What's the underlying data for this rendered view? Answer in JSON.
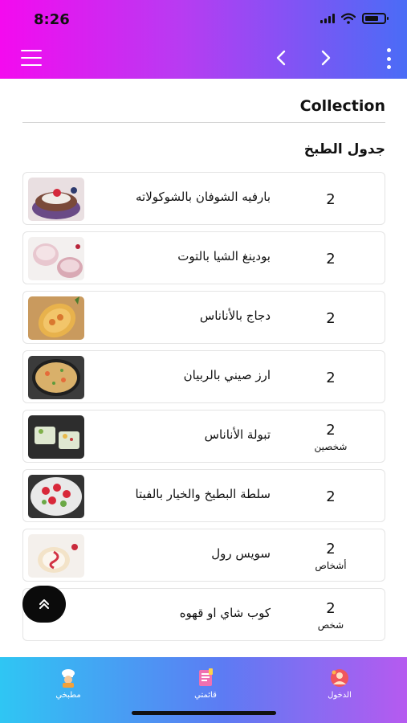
{
  "status_bar": {
    "time": "8:26"
  },
  "header": {
    "collection_title": "Collection",
    "section_title": "جدول الطبخ"
  },
  "recipes": [
    {
      "name": "بارفيه الشوفان بالشوكولاته",
      "servings": "2",
      "unit": ""
    },
    {
      "name": "بودينغ الشيا بالتوت",
      "servings": "2",
      "unit": ""
    },
    {
      "name": "دجاج بالأناناس",
      "servings": "2",
      "unit": ""
    },
    {
      "name": "ارز صيني بالربيان",
      "servings": "2",
      "unit": ""
    },
    {
      "name": "تبولة الأناناس",
      "servings": "2",
      "unit": "شخصين"
    },
    {
      "name": "سلطة البطيخ والخيار بالفيتا",
      "servings": "2",
      "unit": ""
    },
    {
      "name": "سويس رول",
      "servings": "2",
      "unit": "أشخاص"
    },
    {
      "name": "كوب شاي او قهوه",
      "servings": "2",
      "unit": "شخص"
    }
  ],
  "bottom_nav": [
    {
      "label": "مطبخي",
      "icon": "chef-icon"
    },
    {
      "label": "قائمتي",
      "icon": "list-icon"
    },
    {
      "label": "الدخول",
      "icon": "login-icon"
    }
  ],
  "colors": {
    "top_gradient": [
      "#f40aef",
      "#4a6cf6"
    ],
    "bottom_gradient": [
      "#2fc6f3",
      "#b65af0"
    ]
  }
}
